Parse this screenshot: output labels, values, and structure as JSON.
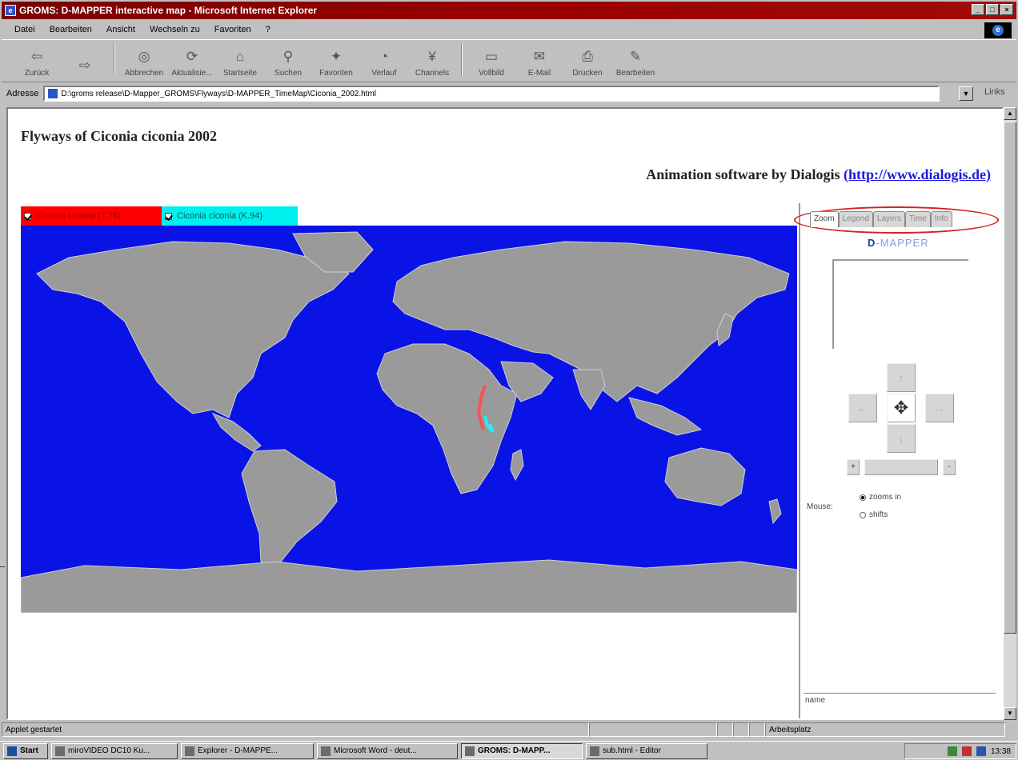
{
  "window": {
    "title": "GROMS: D-MAPPER interactive map - Microsoft Internet Explorer",
    "controls": [
      "_",
      "□",
      "×"
    ]
  },
  "menu": [
    "Datei",
    "Bearbeiten",
    "Ansicht",
    "Wechseln zu",
    "Favoriten",
    "?"
  ],
  "toolbar": [
    {
      "label": "Zurück",
      "icon": "back-icon",
      "glyph": "⇦",
      "enabled": true
    },
    {
      "label": "",
      "icon": "forward-icon",
      "glyph": "⇨",
      "enabled": false
    },
    {
      "label": "Abbrechen",
      "icon": "stop-icon",
      "glyph": "◎",
      "enabled": true
    },
    {
      "label": "Aktualisie...",
      "icon": "refresh-icon",
      "glyph": "⟳",
      "enabled": true
    },
    {
      "label": "Startseite",
      "icon": "home-icon",
      "glyph": "⌂",
      "enabled": true
    },
    {
      "label": "Suchen",
      "icon": "search-icon",
      "glyph": "⚲",
      "enabled": true
    },
    {
      "label": "Favoriten",
      "icon": "favorites-icon",
      "glyph": "✦",
      "enabled": true
    },
    {
      "label": "Verlauf",
      "icon": "history-icon",
      "glyph": "◔",
      "enabled": true
    },
    {
      "label": "Channels",
      "icon": "channels-icon",
      "glyph": "¥",
      "enabled": true
    },
    {
      "label": "Vollbild",
      "icon": "fullscreen-icon",
      "glyph": "▭",
      "enabled": true
    },
    {
      "label": "E-Mail",
      "icon": "mail-icon",
      "glyph": "✉",
      "enabled": true
    },
    {
      "label": "Drucken",
      "icon": "print-icon",
      "glyph": "⎙",
      "enabled": true
    },
    {
      "label": "Bearbeiten",
      "icon": "edit-icon",
      "glyph": "✎",
      "enabled": true
    }
  ],
  "address": {
    "label": "Adresse",
    "value": "D:\\groms release\\D-Mapper_GROMS\\Flyways\\D-MAPPER_TimeMap\\Ciconia_2002.html",
    "links_label": "Links"
  },
  "page": {
    "title": "Flyways of Ciconia ciconia 2002",
    "credit_prefix": "Animation software by Dialogis ",
    "credit_link": "(http://www.dialogis.de)"
  },
  "series": [
    {
      "label": "Ciconia ciconia (7.78)",
      "color": "#ff0000",
      "checked": true
    },
    {
      "label": "Ciconia ciconia (K.94)",
      "color": "#00f0f0",
      "checked": true
    }
  ],
  "map": {
    "ocean_color": "#0a13e6",
    "land_color": "#9a9a9a",
    "track_colors": [
      "#ff5050",
      "#30e8f0"
    ]
  },
  "panel": {
    "tabs": [
      "Zoom",
      "Legend",
      "Layers",
      "Time",
      "Info"
    ],
    "active_tab": "Zoom",
    "brand_prefix": "D",
    "brand_suffix": "-MAPPER",
    "nav": {
      "up": "↑",
      "left": "←",
      "center": "✥",
      "right": "→",
      "down": "↓"
    },
    "zoom_minus": "+",
    "zoom_value": "",
    "zoom_plus": "-",
    "mouse_label": "Mouse:",
    "mouse_options": [
      {
        "label": "zooms in",
        "selected": true
      },
      {
        "label": "shifts",
        "selected": false
      }
    ],
    "name_label": "name"
  },
  "status": {
    "text": "Applet gestartet",
    "zone": "Arbeitsplatz"
  },
  "taskbar": {
    "start": "Start",
    "tasks": [
      {
        "label": "miroVIDEO DC10 Ku...",
        "pressed": false
      },
      {
        "label": "Explorer - D-MAPPE...",
        "pressed": false
      },
      {
        "label": "Microsoft Word - deut...",
        "pressed": false
      },
      {
        "label": "GROMS: D-MAPP...",
        "pressed": true
      },
      {
        "label": "sub.html - Editor",
        "pressed": false
      }
    ],
    "clock": "13:38"
  }
}
